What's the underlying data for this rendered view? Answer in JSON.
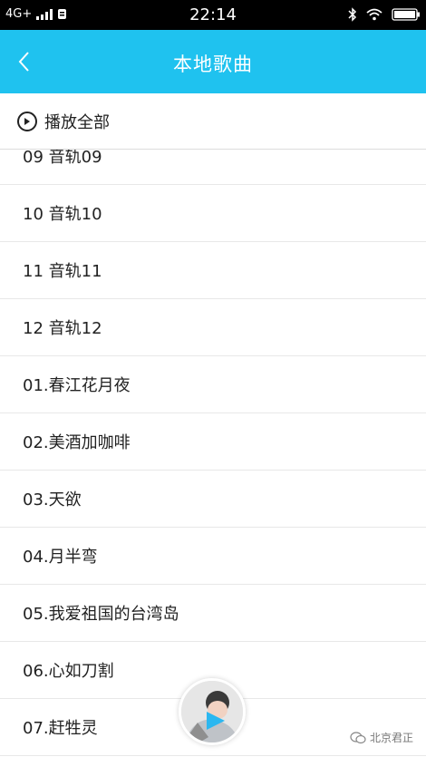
{
  "status_bar": {
    "network": "4G+",
    "time": "22:14"
  },
  "header": {
    "title": "本地歌曲",
    "back_icon": "chevron-left-icon"
  },
  "play_all": {
    "label": "播放全部",
    "icon": "play-circle-icon"
  },
  "songs": [
    "09 音轨09",
    "10 音轨10",
    "11 音轨11",
    "12 音轨12",
    "01.春江花月夜",
    "02.美酒加咖啡",
    "03.天欲",
    "04.月半弯",
    "05.我爱祖国的台湾岛",
    "06.心如刀割",
    "07.赶牲灵"
  ],
  "watermark": {
    "text": "北京君正",
    "icon": "wechat-icon"
  },
  "colors": {
    "header_bg": "#1fc2ef",
    "status_bar_bg": "#000000"
  }
}
